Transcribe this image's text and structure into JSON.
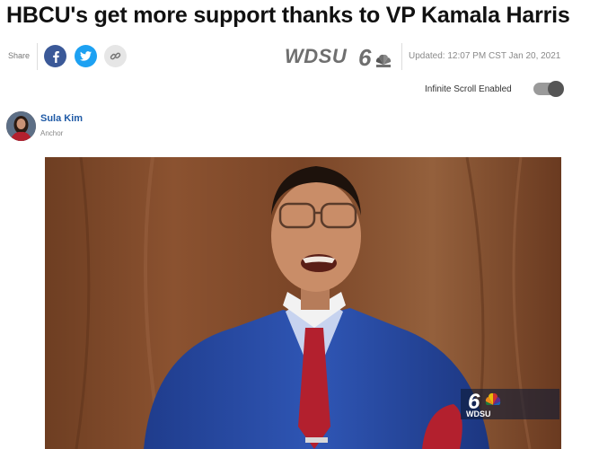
{
  "article": {
    "headline": "HBCU's get more support thanks to VP Kamala Harris"
  },
  "share": {
    "label": "Share",
    "buttons": [
      {
        "name": "facebook",
        "icon": "facebook-icon",
        "color": "#3b5998"
      },
      {
        "name": "twitter",
        "icon": "twitter-icon",
        "color": "#1da1f2"
      },
      {
        "name": "copy-link",
        "icon": "link-icon",
        "color": "#e6e6e6"
      }
    ]
  },
  "station": {
    "logo_text": "WDSU",
    "logo_number": "6"
  },
  "meta": {
    "updated": "Updated: 12:07 PM CST Jan 20, 2021"
  },
  "infinite_scroll": {
    "label": "Infinite Scroll Enabled",
    "enabled": true
  },
  "author": {
    "name": "Sula Kim",
    "role": "Anchor"
  },
  "video": {
    "bug_number": "6",
    "bug_text": "WDSU"
  },
  "colors": {
    "author_link": "#1f5aa6",
    "facebook": "#3b5998",
    "twitter": "#1da1f2"
  }
}
